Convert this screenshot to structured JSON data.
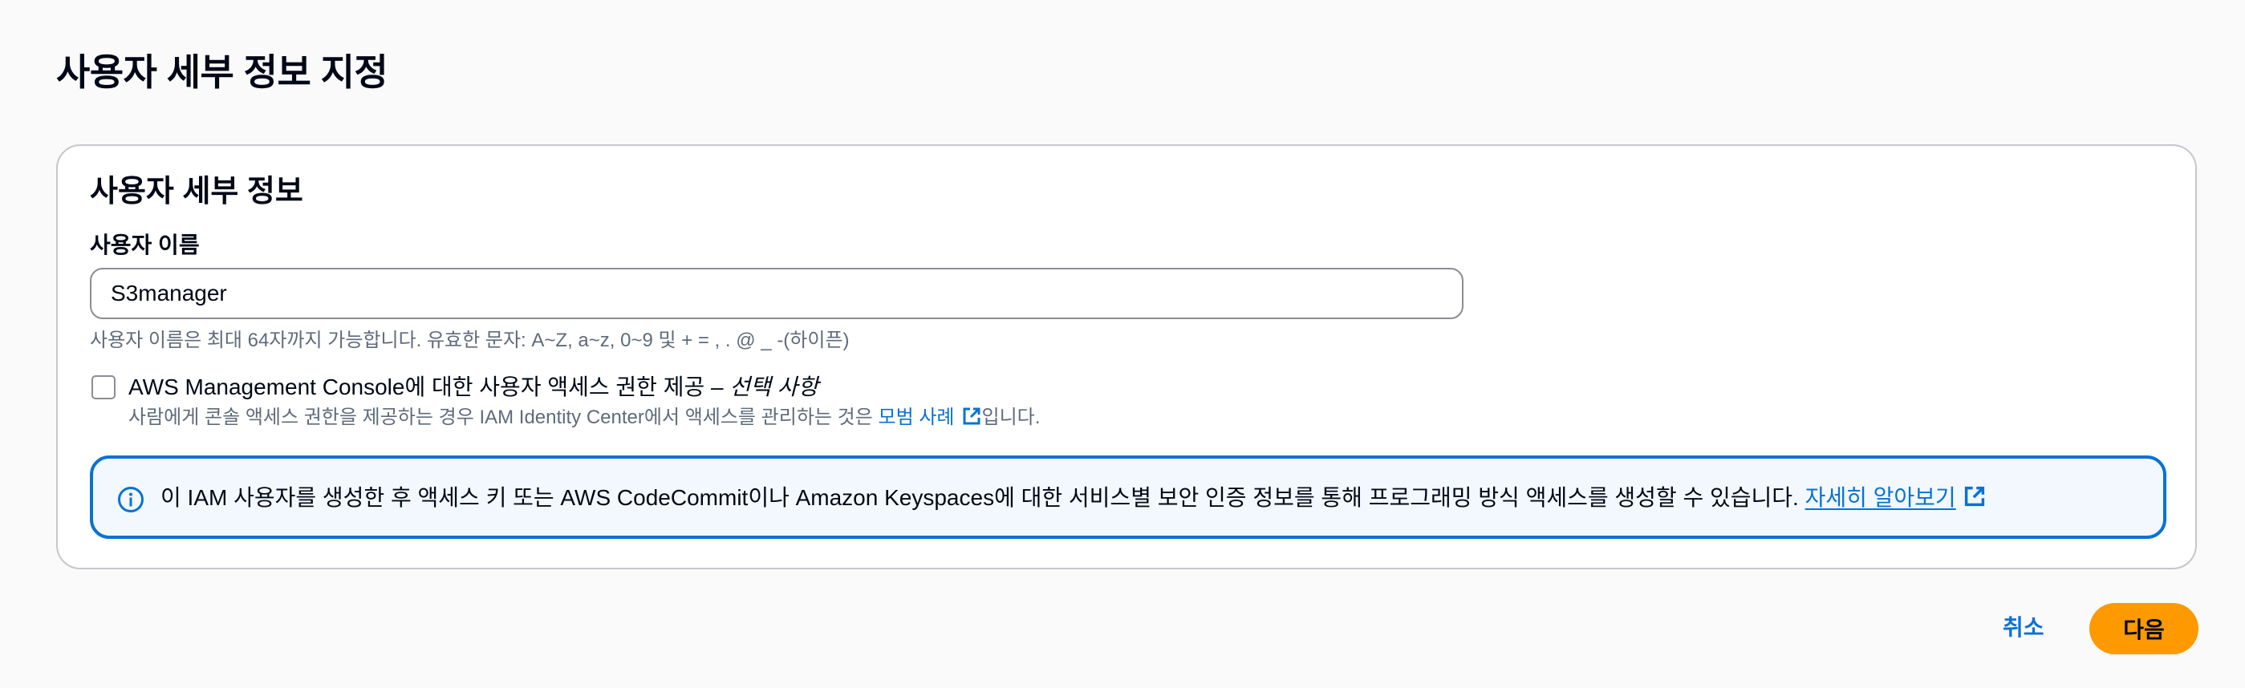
{
  "page": {
    "title": "사용자 세부 정보 지정"
  },
  "user_details": {
    "section_title": "사용자 세부 정보",
    "username_label": "사용자 이름",
    "username_value": "S3manager",
    "username_constraint": "사용자 이름은 최대 64자까지 가능합니다. 유효한 문자: A~Z, a~z, 0~9 및 + = , . @ _ -(하이픈)",
    "console_access": {
      "label": "AWS Management Console에 대한 사용자 액세스 권한 제공 – ",
      "label_optional": "선택 사항",
      "checked": false,
      "description_prefix": "사람에게 콘솔 액세스 권한을 제공하는 경우 IAM Identity Center에서 액세스를 관리하는 것은 ",
      "description_link": "모범 사례",
      "description_suffix": "입니다."
    },
    "info_alert": {
      "text": "이 IAM 사용자를 생성한 후 액세스 키 또는 AWS CodeCommit이나 Amazon Keyspaces에 대한 서비스별 보안 인증 정보를 통해 프로그래밍 방식 액세스를 생성할 수 있습니다. ",
      "link": "자세히 알아보기"
    }
  },
  "actions": {
    "cancel_label": "취소",
    "next_label": "다음"
  },
  "colors": {
    "accent_link": "#0972d3",
    "primary_button": "#ff9900",
    "info_border": "#0972d3",
    "info_background": "#f2f8fd"
  }
}
